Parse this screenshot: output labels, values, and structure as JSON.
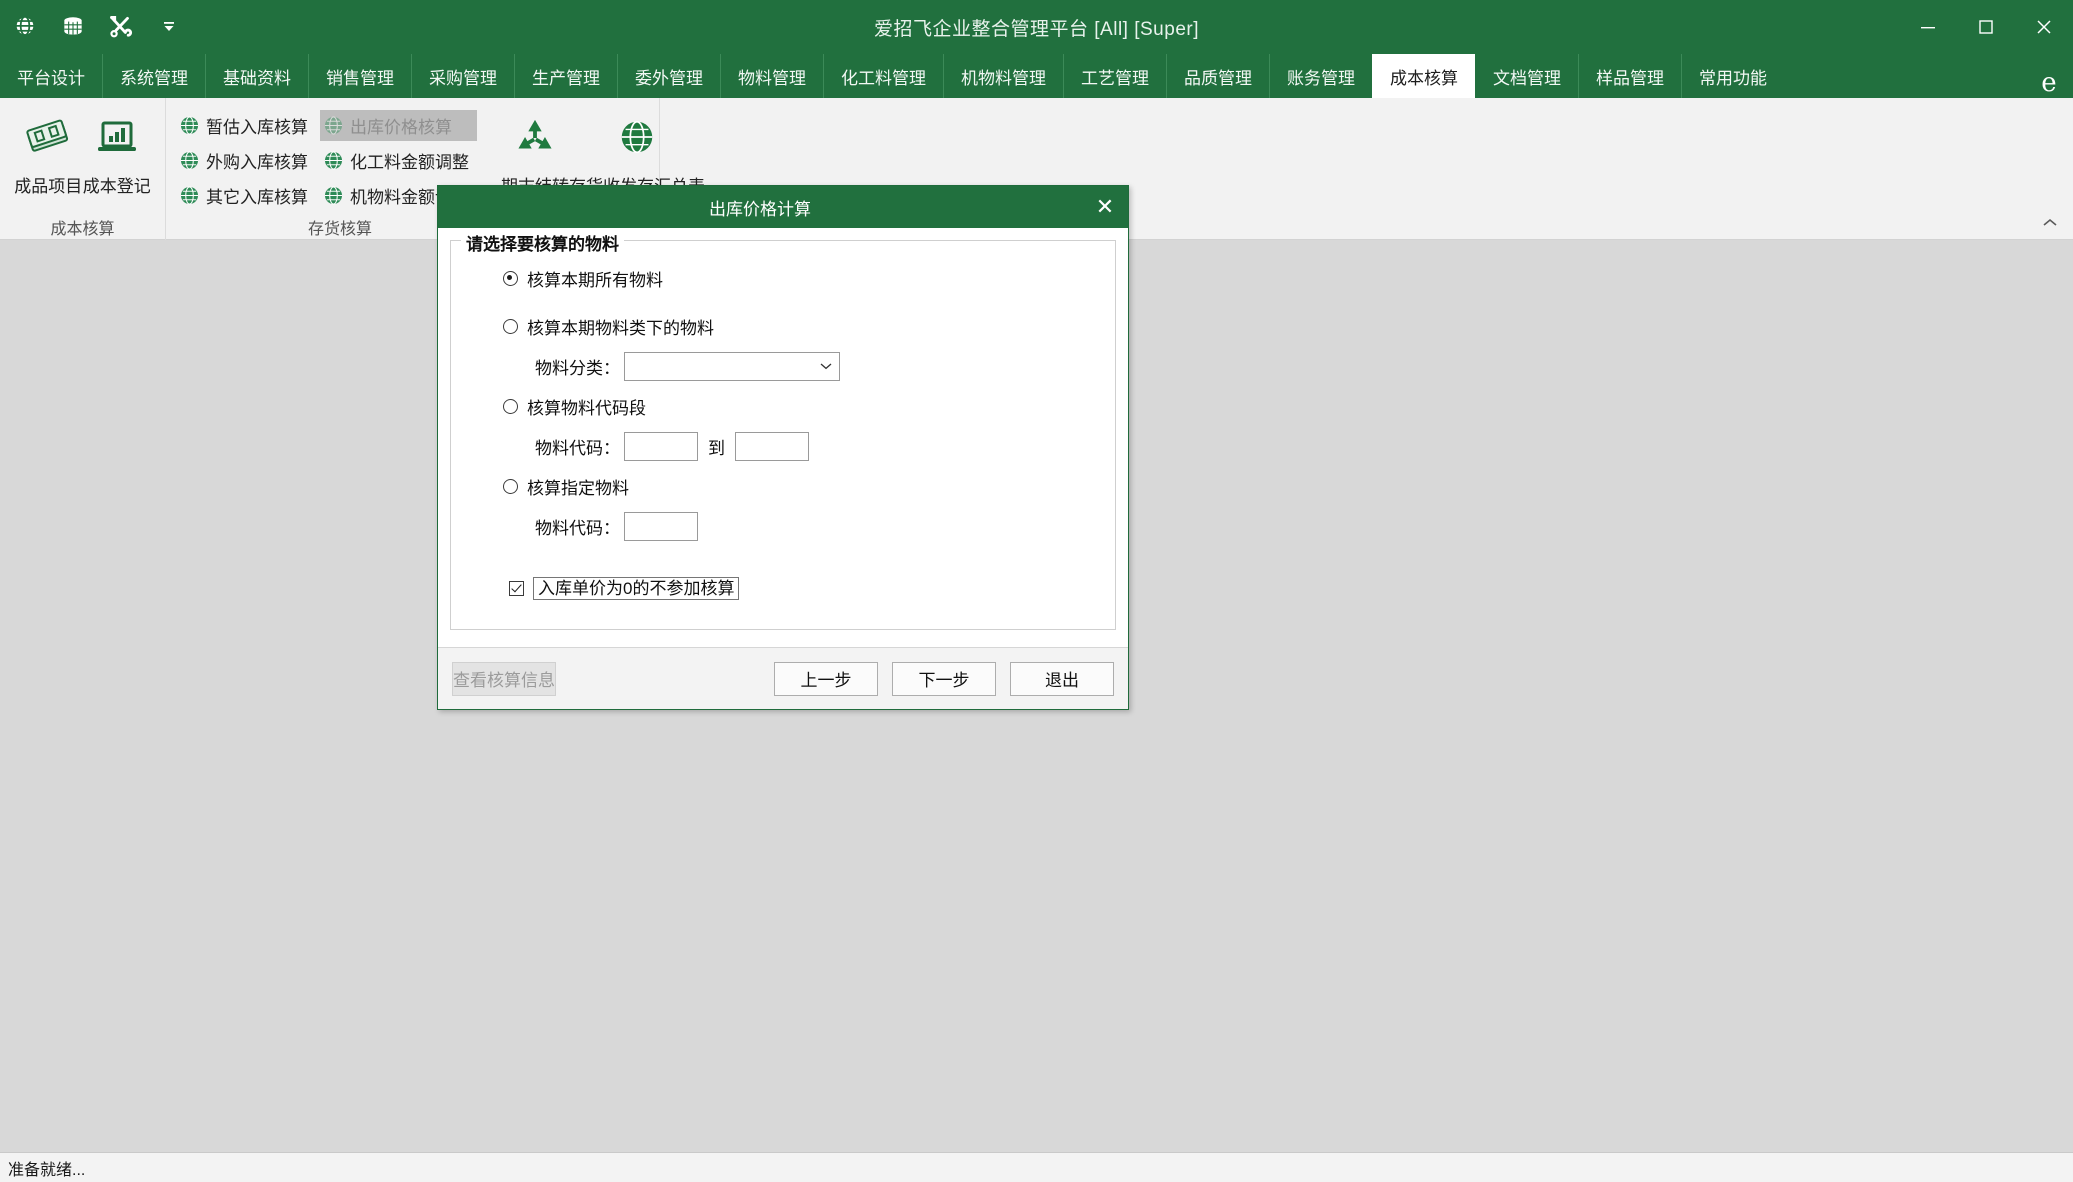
{
  "window": {
    "title": "爱招飞企业整合管理平台 [All] [Super]",
    "quick_access": [
      {
        "name": "globe-icon",
        "label": "globe-icon"
      },
      {
        "name": "database-icon",
        "label": "database-icon"
      },
      {
        "name": "tools-icon",
        "label": "tools-icon"
      },
      {
        "name": "chevron-down-icon",
        "label": "chevron-down-icon"
      }
    ],
    "controls": {
      "minimize": "minimize-icon",
      "maximize": "maximize-icon",
      "close": "close-icon"
    }
  },
  "tabs": [
    {
      "label": "平台设计",
      "active": false
    },
    {
      "label": "系统管理",
      "active": false
    },
    {
      "label": "基础资料",
      "active": false
    },
    {
      "label": "销售管理",
      "active": false
    },
    {
      "label": "采购管理",
      "active": false
    },
    {
      "label": "生产管理",
      "active": false
    },
    {
      "label": "委外管理",
      "active": false
    },
    {
      "label": "物料管理",
      "active": false
    },
    {
      "label": "化工料管理",
      "active": false
    },
    {
      "label": "机物料管理",
      "active": false
    },
    {
      "label": "工艺管理",
      "active": false
    },
    {
      "label": "品质管理",
      "active": false
    },
    {
      "label": "账务管理",
      "active": false
    },
    {
      "label": "成本核算",
      "active": true
    },
    {
      "label": "文档管理",
      "active": false
    },
    {
      "label": "样品管理",
      "active": false
    },
    {
      "label": "常用功能",
      "active": false
    }
  ],
  "tab_end_icon": "e",
  "ribbon": {
    "groups": [
      {
        "title": "成本核算",
        "big_buttons": [
          {
            "label": "成品项目",
            "icon": "money-stack-icon"
          },
          {
            "label": "成本登记",
            "icon": "chart-laptop-icon"
          }
        ],
        "small_buttons": []
      },
      {
        "title": "存货核算",
        "big_buttons": [
          {
            "label": "期末结转",
            "icon": "recycle-icon"
          },
          {
            "label": "存货收发存汇总表",
            "icon": "globe-grid-icon"
          }
        ],
        "small_columns": [
          [
            {
              "label": "暂估入库核算",
              "icon": "globe-icon",
              "pressed": false
            },
            {
              "label": "外购入库核算",
              "icon": "globe-icon",
              "pressed": false
            },
            {
              "label": "其它入库核算",
              "icon": "globe-icon",
              "pressed": false
            }
          ],
          [
            {
              "label": "出库价格核算",
              "icon": "globe-icon",
              "pressed": true
            },
            {
              "label": "化工料金额调整",
              "icon": "globe-icon",
              "pressed": false
            },
            {
              "label": "机物料金额调整",
              "icon": "globe-icon",
              "pressed": false
            }
          ]
        ]
      }
    ],
    "collapse_icon": "chevron-up-icon"
  },
  "dialog": {
    "title": "出库价格计算",
    "close_label": "✕",
    "group_legend": "请选择要核算的物料",
    "options": [
      {
        "label": "核算本期所有物料",
        "selected": true
      },
      {
        "label": "核算本期物料类下的物料",
        "selected": false
      },
      {
        "label": "核算物料代码段",
        "selected": false
      },
      {
        "label": "核算指定物料",
        "selected": false
      }
    ],
    "fields": {
      "category_label": "物料分类：",
      "category_value": "",
      "category_placeholder": "",
      "code_range_label": "物料代码：",
      "code_from_value": "",
      "code_to_value": "",
      "range_separator": "到",
      "code_single_label": "物料代码：",
      "code_single_value": ""
    },
    "checkbox": {
      "label": "入库单价为0的不参加核算",
      "checked": true
    },
    "buttons": {
      "view_info": "查看核算信息",
      "prev": "上一步",
      "next": "下一步",
      "exit": "退出"
    }
  },
  "statusbar": {
    "text": "准备就绪..."
  },
  "colors": {
    "brand_green": "#21703e",
    "ribbon_bg": "#f2f2f2",
    "workspace_bg": "#d8d8d8",
    "pressed_gray": "#bdbdbd"
  }
}
